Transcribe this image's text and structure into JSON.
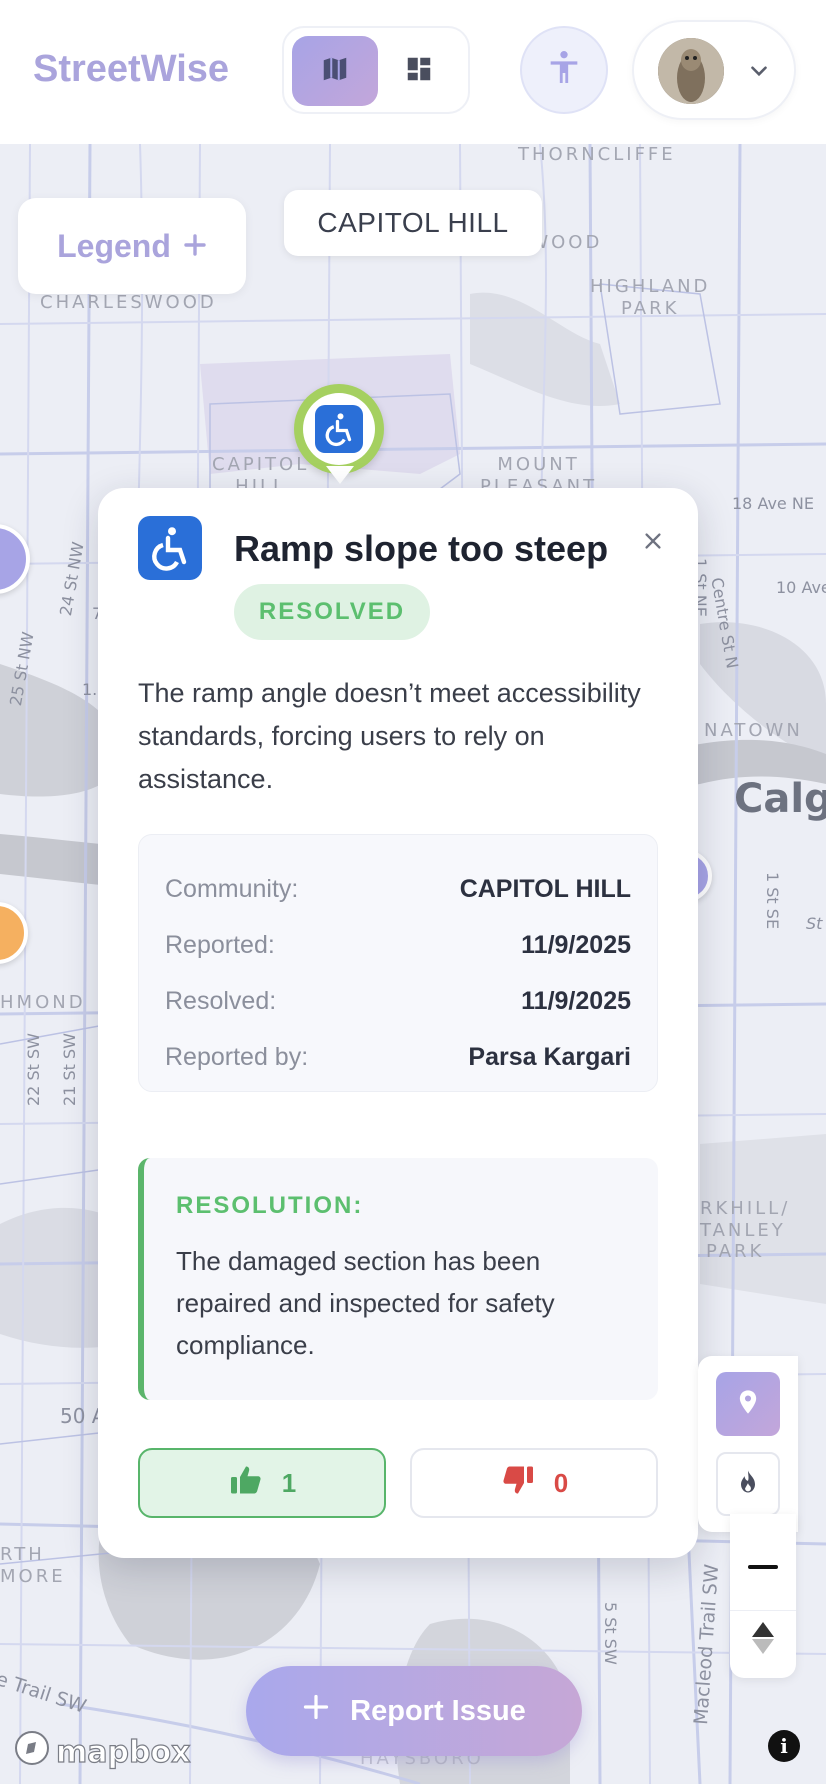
{
  "header": {
    "brand": "StreetWise",
    "view_toggle": {
      "map_icon": "map-icon",
      "dashboard_icon": "dashboard-icon",
      "active": "map"
    },
    "accessibility_icon": "accessibility-person-icon",
    "profile": {
      "avatar": "avatar-meerkat",
      "chevron": "chevron-down-icon"
    }
  },
  "map": {
    "legend_label": "Legend",
    "legend_icon": "plus-icon",
    "community_chip": "CAPITOL HILL",
    "labels": {
      "thorncliffe": "THORNCLIFFE",
      "highwood": "HIGHWOOD",
      "highland_park_1": "HIGHLAND",
      "highland_park_2": "PARK",
      "charleswood": "CHARLESWOOD",
      "capitol_hill_1": "CAPITOL",
      "capitol_hill_2": "HILL",
      "mount_pleasant_1": "MOUNT",
      "mount_pleasant_2": "PLEASANT",
      "chinatown": "NATOWN",
      "richmond": "HMOND",
      "parkhill_1": "RKHILL/",
      "parkhill_2": "TANLEY",
      "parkhill_3": "PARK",
      "north_1": "RTH",
      "north_2": "MORE",
      "haysboro": "HAYSBORO",
      "city": "Calga"
    },
    "streets": {
      "s18ave": "18 Ave NE",
      "s10ave": "10 Ave",
      "s1stne": "1 St NE",
      "centre": "Centre St N",
      "s24st": "24 St NW",
      "s25st": "25 St NW",
      "s1sts": "1 St SE",
      "s22st": "22 St SW",
      "s21st": "21 St SW",
      "s50a": "50 A",
      "s5st": "5 St SW",
      "macleod": "Macleod Trail SW",
      "etrail": "e Trail SW",
      "st": "St",
      "seven": "7",
      "one": "1."
    }
  },
  "issue": {
    "icon": "wheelchair-icon",
    "title": "Ramp slope too steep",
    "status": "RESOLVED",
    "description": "The ramp angle doesn’t meet accessibility standards, forcing users to rely on assistance.",
    "details": [
      {
        "label": "Community:",
        "value": "CAPITOL HILL"
      },
      {
        "label": "Reported:",
        "value": "11/9/2025"
      },
      {
        "label": "Resolved:",
        "value": "11/9/2025"
      },
      {
        "label": "Reported by:",
        "value": "Parsa Kargari"
      }
    ],
    "resolution_label": "RESOLUTION:",
    "resolution_text": "The damaged section has been repaired and inspected for safety compliance.",
    "upvotes": "1",
    "downvotes": "0"
  },
  "controls": {
    "layer_pins_icon": "map-pin-icon",
    "layer_heat_icon": "flame-icon",
    "zoom_out_icon": "minus-icon",
    "compass_icon": "compass-icon"
  },
  "report_button": "Report Issue",
  "attribution": {
    "mapbox": "mapbox",
    "info": "i"
  },
  "colors": {
    "brand": "#aaa4dc",
    "accent_gradient_start": "#a7a4e6",
    "accent_gradient_end": "#c3a6da",
    "resolved_green": "#5cbf6f",
    "downvote_red": "#d94a46",
    "issue_blue": "#2a6fd8",
    "pin_green": "#a5d060"
  }
}
